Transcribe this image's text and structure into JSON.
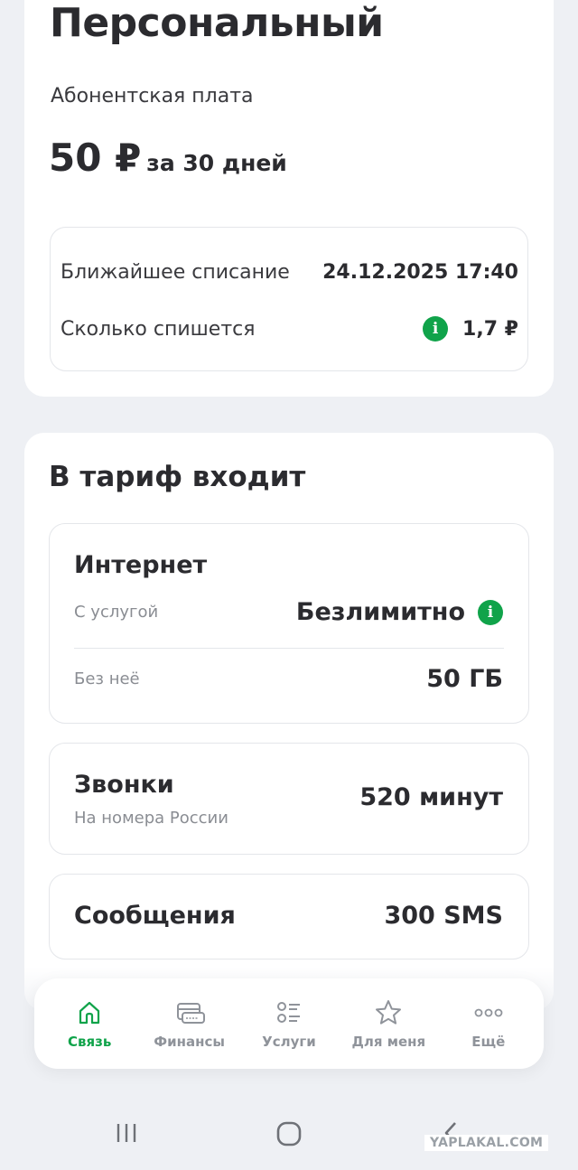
{
  "tariff": {
    "name": "Персональный",
    "fee_label": "Абонентская плата",
    "fee_amount": "50 ₽",
    "fee_period": "за 30 дней",
    "next_charge_label": "Ближайшее списание",
    "next_charge_value": "24.12.2025 17:40",
    "charge_amount_label": "Сколько спишется",
    "charge_amount_value": "1,7 ₽"
  },
  "includes": {
    "title": "В тариф входит",
    "internet": {
      "title": "Интернет",
      "with_service_label": "С услугой",
      "with_service_value": "Безлимитно",
      "without_service_label": "Без неё",
      "without_service_value": "50 ГБ"
    },
    "calls": {
      "title": "Звонки",
      "subtitle": "На номера России",
      "value": "520 минут"
    },
    "sms": {
      "title": "Сообщения",
      "value": "300 SMS"
    }
  },
  "bottom_nav": {
    "items": [
      {
        "label": "Связь",
        "icon": "home-icon",
        "active": true
      },
      {
        "label": "Финансы",
        "icon": "card-icon",
        "active": false
      },
      {
        "label": "Услуги",
        "icon": "list-icon",
        "active": false
      },
      {
        "label": "Для меня",
        "icon": "star-icon",
        "active": false
      },
      {
        "label": "Ещё",
        "icon": "more-icon",
        "active": false
      }
    ]
  },
  "colors": {
    "accent": "#10a34a",
    "inactive": "#8f939a",
    "background": "#eef0f4"
  },
  "watermark": "YAPLAKAL.COM"
}
